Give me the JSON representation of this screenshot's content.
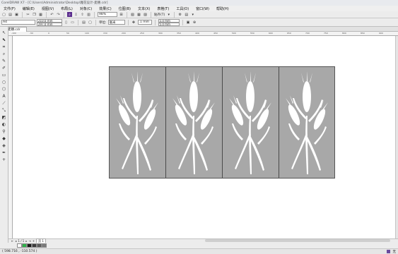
{
  "window": {
    "title": "CorelDRAW X7 - [C:\\Users\\Administrator\\Desktop\\雕花设计-麦穗.cdr]"
  },
  "menu": [
    "文件(F)",
    "编辑(E)",
    "视图(V)",
    "布局(L)",
    "对象(C)",
    "效果(C)",
    "位图(B)",
    "文本(X)",
    "表格(T)",
    "工具(O)",
    "窗口(W)",
    "帮助(H)"
  ],
  "toolbar": {
    "zoom_value": "98%",
    "snap_label": "贴齐(T)",
    "page_size": "A4",
    "width_value": "210.0 mm",
    "height_value": "297.0 mm",
    "units_label": "单位:",
    "units_value": "毫米",
    "nudge_value": ".1 mm",
    "dup_x": "5.0 mm",
    "dup_y": "5.0 mm"
  },
  "doc_tab": {
    "label": "麦穗.cdr"
  },
  "ruler_ticks": [
    "-100",
    "-50",
    "0",
    "50",
    "100",
    "150",
    "200",
    "250",
    "300",
    "350",
    "400",
    "450",
    "500",
    "550",
    "600",
    "650",
    "700",
    "750",
    "800",
    "850",
    "900"
  ],
  "pagebar": {
    "page_of": "1 / 1",
    "page_tab": "页 1"
  },
  "status": {
    "coords": "( 598.716 , -110.574 )",
    "right_label": "无"
  },
  "colors": {
    "accent": "#5b2d8e",
    "artboard": "#a8a8a8",
    "wheat": "#ffffff"
  },
  "palette": [
    "#ffffff",
    "#2db34a",
    "#1a1a1a",
    "#3c3c3c",
    "#5a5a5a",
    "#7a7a7a"
  ]
}
